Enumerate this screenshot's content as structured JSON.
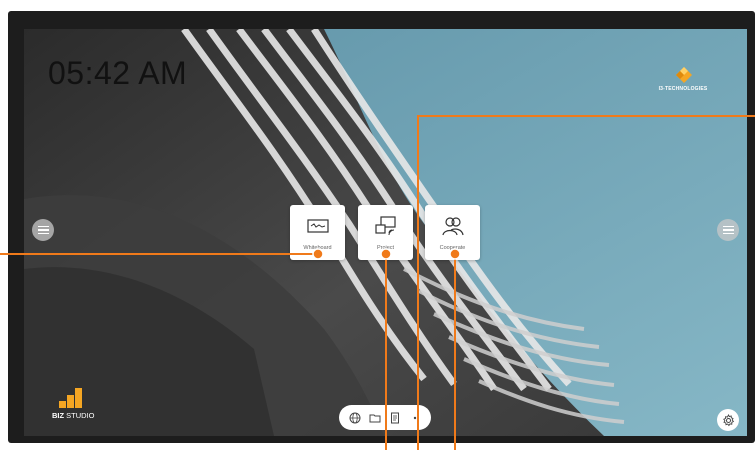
{
  "screen": {
    "clock": "05:42 AM",
    "brand_name": "I3-TECHNOLOGIES",
    "biz_logo": {
      "bold": "BIZ",
      "rest": " STUDIO"
    }
  },
  "tiles": [
    {
      "label": "Whiteboard",
      "icon": "whiteboard-icon"
    },
    {
      "label": "Project",
      "icon": "project-screen-icon"
    },
    {
      "label": "Cooperate",
      "icon": "cooperate-users-icon"
    }
  ],
  "dock": {
    "icons": [
      "globe-icon",
      "folder-icon",
      "document-icon",
      "more-icon"
    ]
  },
  "side_handles": [
    "left-menu-handle",
    "right-menu-handle"
  ],
  "settings_icon": "gear-icon",
  "colors": {
    "accent_orange": "#f07a1a",
    "sky": "#6fa1b3",
    "bezel": "#1d1d1d",
    "logo_yellow": "#f5a623"
  }
}
